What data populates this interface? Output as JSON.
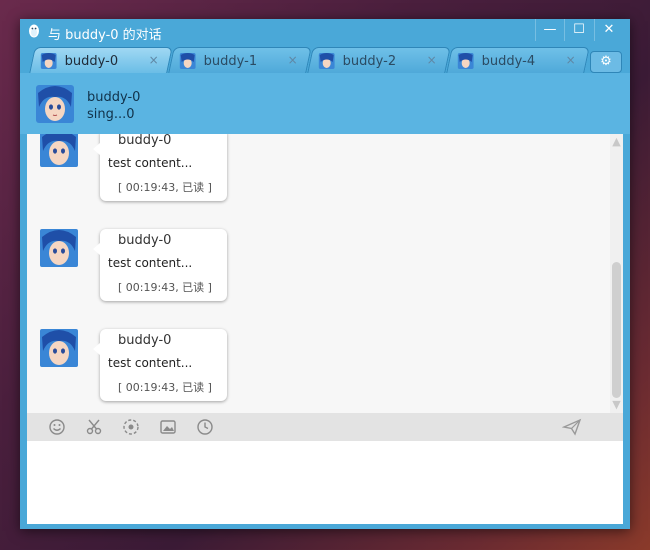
{
  "window": {
    "title": "与 buddy-0 的对话"
  },
  "tabs": [
    {
      "label": "buddy-0",
      "active": true
    },
    {
      "label": "buddy-1",
      "active": false
    },
    {
      "label": "buddy-2",
      "active": false
    },
    {
      "label": "buddy-4",
      "active": false
    }
  ],
  "tab_close_glyph": "×",
  "header": {
    "name": "buddy-0",
    "status": "sing...0"
  },
  "messages": [
    {
      "sender": "buddy-0",
      "text": "test content...",
      "time": "[ 00:19:43, 已读 ]"
    },
    {
      "sender": "buddy-0",
      "text": "test content...",
      "time": "[ 00:19:43, 已读 ]"
    },
    {
      "sender": "buddy-0",
      "text": "test content...",
      "time": "[ 00:19:43, 已读 ]"
    }
  ],
  "toolbar": {
    "icons": [
      "emoji-icon",
      "scissors-icon",
      "screenshot-icon",
      "image-icon",
      "history-clock-icon",
      "send-icon"
    ]
  },
  "colors": {
    "window": "#4aa8d8",
    "header": "#5ab4e2",
    "chat_bg": "#f7f7f7",
    "toolbar": "#e3e3e3"
  }
}
